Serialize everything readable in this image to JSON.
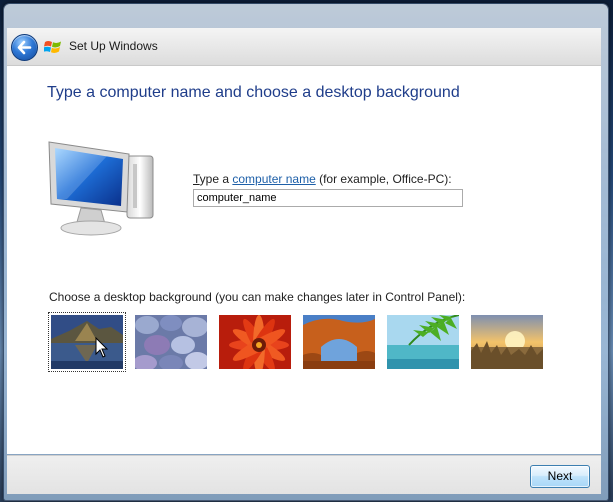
{
  "window": {
    "title": "Set Up Windows"
  },
  "page": {
    "heading": "Type a computer name and choose a desktop background"
  },
  "name_section": {
    "label_prefix_underlined": "T",
    "label_prefix_rest": "ype a ",
    "label_link": "computer name",
    "label_suffix": " (for example, Office-PC):",
    "input_value": "computer_name"
  },
  "background_section": {
    "label": "Choose a desktop background (you can make changes later in Control Panel):",
    "thumbnails": [
      {
        "icon": "mountain-lake-wallpaper",
        "selected": true
      },
      {
        "icon": "pebbles-wallpaper",
        "selected": false
      },
      {
        "icon": "red-flower-wallpaper",
        "selected": false
      },
      {
        "icon": "rock-arch-wallpaper",
        "selected": false
      },
      {
        "icon": "palm-leaf-wallpaper",
        "selected": false
      },
      {
        "icon": "sunset-field-wallpaper",
        "selected": false
      }
    ]
  },
  "footer": {
    "next_label": "Next"
  },
  "colors": {
    "heading": "#1f3d8a",
    "link": "#1d5fa8",
    "next_border": "#3c7fb1"
  }
}
